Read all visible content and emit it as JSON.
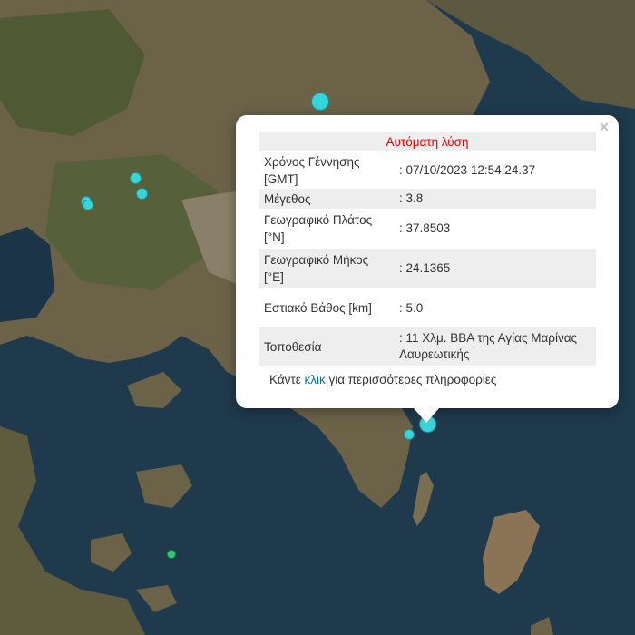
{
  "popup": {
    "title": "Αυτόματη λύση",
    "close_label": "×",
    "rows": [
      {
        "label": "Χρόνος Γέννησης [GMT]",
        "value": ": 07/10/2023 12:54:24.37"
      },
      {
        "label": "Μέγεθος",
        "value": ": 3.8"
      },
      {
        "label": "Γεωγραφικό Πλάτος [°N]",
        "value": ": 37.8503"
      },
      {
        "label": "Γεωγραφικό Μήκος [°E]",
        "value": ": 24.1365"
      },
      {
        "label": "Εστιακό Βάθος [km]",
        "value": ": 5.0"
      },
      {
        "label": "Τοποθεσία",
        "value": ": 11 Χλμ. ΒΒΑ της Αγίας Μαρίνας Λαυρεωτικής"
      }
    ],
    "more_prefix": "Κάντε ",
    "more_link": "κλικ",
    "more_suffix": " για περισσότερες πληροφορίες"
  },
  "colors": {
    "sea": "#1f3a4d",
    "land": "#6b6248",
    "marker_cyan": "#38d4dc",
    "marker_green": "#2ecc71",
    "title_red": "#e60000",
    "link_blue": "#0078a8"
  },
  "markers": [
    {
      "name": "earthquake-marker",
      "color": "cyan"
    },
    {
      "name": "earthquake-marker",
      "color": "cyan"
    },
    {
      "name": "earthquake-marker",
      "color": "cyan"
    },
    {
      "name": "earthquake-marker",
      "color": "cyan"
    },
    {
      "name": "earthquake-marker",
      "color": "cyan"
    },
    {
      "name": "earthquake-marker-selected",
      "color": "cyan"
    },
    {
      "name": "earthquake-marker",
      "color": "cyan"
    },
    {
      "name": "earthquake-marker",
      "color": "green"
    }
  ]
}
